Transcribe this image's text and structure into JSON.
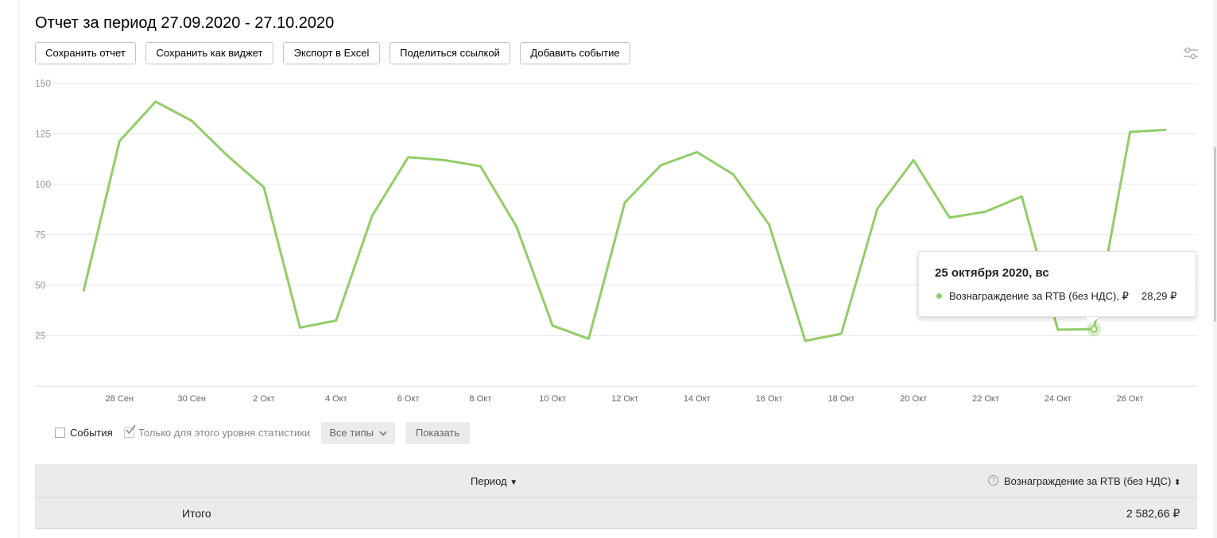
{
  "page": {
    "title": "Отчет за период 27.09.2020 - 27.10.2020"
  },
  "toolbar": {
    "save_report": "Сохранить отчет",
    "save_widget": "Сохранить как виджет",
    "export_excel": "Экспорт в Excel",
    "share_link": "Поделиться ссылкой",
    "add_event": "Добавить событие",
    "settings_icon": "sliders-icon"
  },
  "chart_data": {
    "type": "line",
    "x": [
      "27 Сен",
      "28 Сен",
      "29 Сен",
      "30 Сен",
      "1 Окт",
      "2 Окт",
      "3 Окт",
      "4 Окт",
      "5 Окт",
      "6 Окт",
      "7 Окт",
      "8 Окт",
      "9 Окт",
      "10 Окт",
      "11 Окт",
      "12 Окт",
      "13 Окт",
      "14 Окт",
      "15 Окт",
      "16 Окт",
      "17 Окт",
      "18 Окт",
      "19 Окт",
      "20 Окт",
      "21 Окт",
      "22 Окт",
      "23 Окт",
      "24 Окт",
      "25 Окт",
      "26 Окт",
      "27 Окт"
    ],
    "x_tick_labels": [
      "28 Сен",
      "30 Сен",
      "2 Окт",
      "4 Окт",
      "6 Окт",
      "8 Окт",
      "10 Окт",
      "12 Окт",
      "14 Окт",
      "16 Окт",
      "18 Окт",
      "20 Окт",
      "22 Окт",
      "24 Окт",
      "26 Окт"
    ],
    "series": [
      {
        "name": "Вознаграждение за RTB (без НДС), ₽",
        "color": "#92cd68",
        "values": [
          47,
          121.5,
          141,
          131.5,
          114,
          98.5,
          29,
          32.5,
          84.5,
          113.5,
          112,
          109,
          79,
          30,
          23.5,
          91,
          109.5,
          116,
          105,
          80,
          22.5,
          26,
          88,
          112,
          83.5,
          86.5,
          94,
          28,
          28.29,
          126,
          127
        ]
      }
    ],
    "y_ticks": [
      25,
      50,
      75,
      100,
      125,
      150
    ],
    "ylim": [
      0,
      150
    ],
    "grid": true,
    "title": "",
    "xlabel": "",
    "ylabel": ""
  },
  "tooltip": {
    "date": "25 октября 2020, вс",
    "series_label": "Вознаграждение за RTB (без НДС), ₽",
    "separator": ".",
    "value": "28,29 ₽",
    "highlight_index": 28
  },
  "filters": {
    "events_label": "События",
    "events_checked": false,
    "level_only_label": "Только для этого уровня статистики",
    "level_only_checked": true,
    "all_types": "Все типы",
    "show": "Показать"
  },
  "table": {
    "col_period": "Период",
    "col_reward": "Вознаграждение за RTB (без НДС)",
    "total_label": "Итого",
    "total_value": "2 582,66 ₽"
  }
}
